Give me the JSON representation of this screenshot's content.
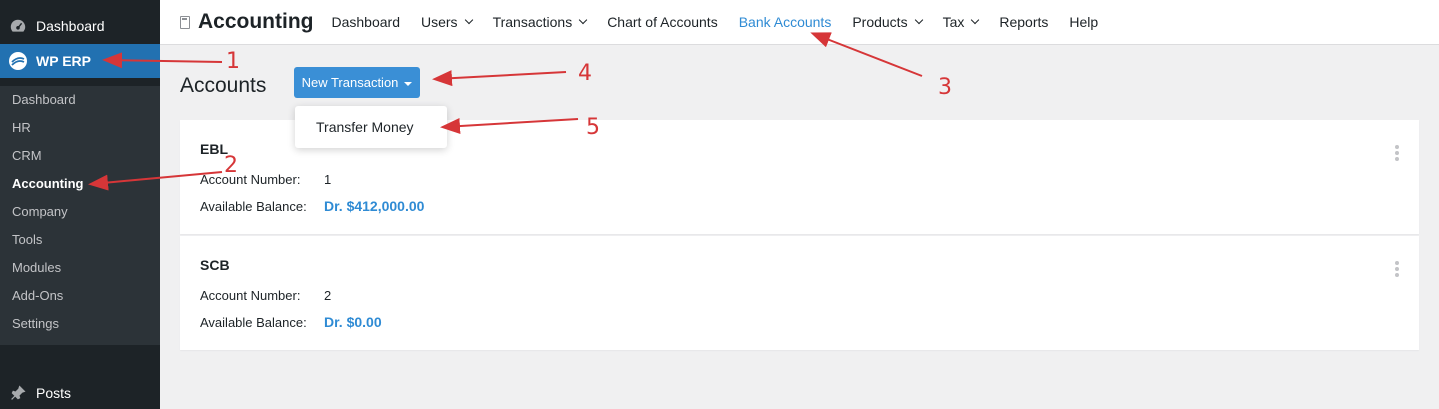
{
  "sidebar": {
    "dashboard": "Dashboard",
    "wperp": "WP ERP",
    "items": [
      "Dashboard",
      "HR",
      "CRM",
      "Accounting",
      "Company",
      "Tools",
      "Modules",
      "Add-Ons",
      "Settings"
    ],
    "posts": "Posts"
  },
  "topnav": {
    "brand": "Accounting",
    "items": [
      {
        "label": "Dashboard"
      },
      {
        "label": "Users"
      },
      {
        "label": "Transactions"
      },
      {
        "label": "Chart of Accounts"
      },
      {
        "label": "Bank Accounts"
      },
      {
        "label": "Products"
      },
      {
        "label": "Tax"
      },
      {
        "label": "Reports"
      },
      {
        "label": "Help"
      }
    ]
  },
  "main": {
    "title": "Accounts",
    "new_transaction": "New Transaction",
    "dropdown": [
      "Transfer Money"
    ],
    "accounts": [
      {
        "name": "EBL",
        "number_label": "Account Number:",
        "number": "1",
        "balance_label": "Available Balance:",
        "balance": "Dr. $412,000.00"
      },
      {
        "name": "SCB",
        "number_label": "Account Number:",
        "number": "2",
        "balance_label": "Available Balance:",
        "balance": "Dr. $0.00"
      }
    ]
  },
  "annotations": [
    "1",
    "2",
    "3",
    "4",
    "5"
  ],
  "colors": {
    "accent": "#2f8bd4",
    "button": "#3a8fd6",
    "sidebar": "#1d2327",
    "highlight": "#2271b1",
    "annotation": "#d63638"
  }
}
